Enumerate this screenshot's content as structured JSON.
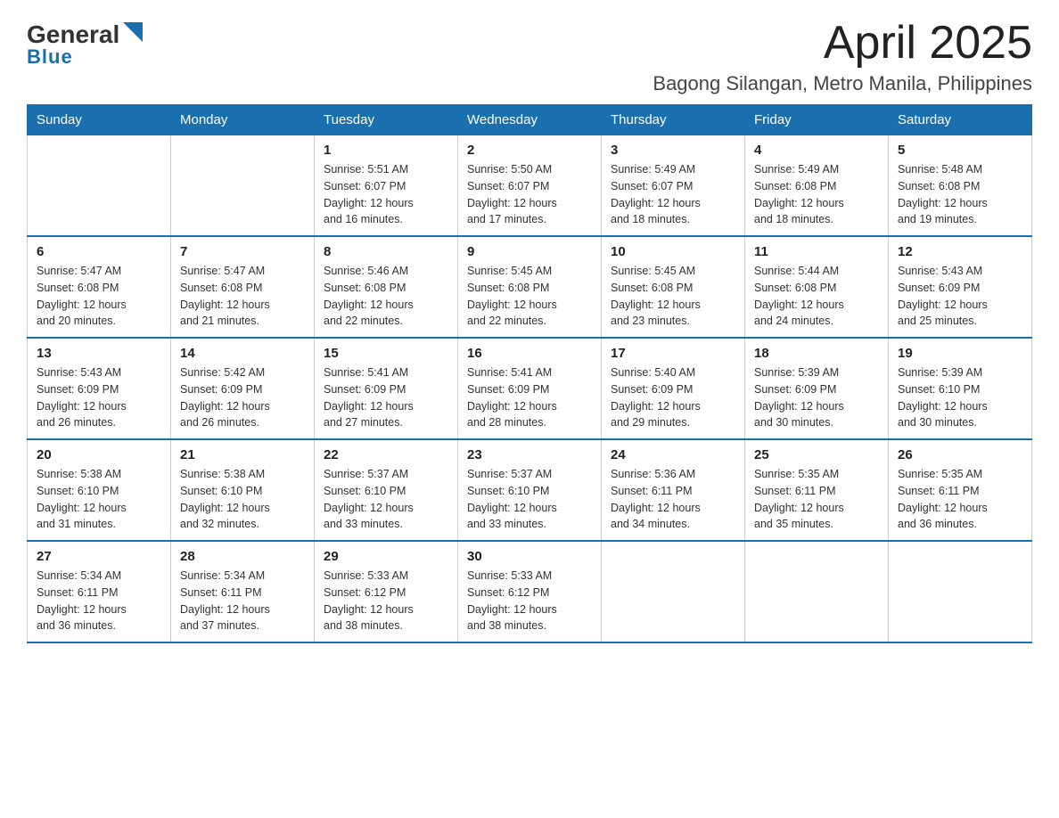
{
  "logo": {
    "line1_black": "General",
    "line1_blue": "Blue",
    "line2": "Blue"
  },
  "header": {
    "month_year": "April 2025",
    "location": "Bagong Silangan, Metro Manila, Philippines"
  },
  "weekdays": [
    "Sunday",
    "Monday",
    "Tuesday",
    "Wednesday",
    "Thursday",
    "Friday",
    "Saturday"
  ],
  "weeks": [
    [
      {
        "day": "",
        "info": ""
      },
      {
        "day": "",
        "info": ""
      },
      {
        "day": "1",
        "info": "Sunrise: 5:51 AM\nSunset: 6:07 PM\nDaylight: 12 hours\nand 16 minutes."
      },
      {
        "day": "2",
        "info": "Sunrise: 5:50 AM\nSunset: 6:07 PM\nDaylight: 12 hours\nand 17 minutes."
      },
      {
        "day": "3",
        "info": "Sunrise: 5:49 AM\nSunset: 6:07 PM\nDaylight: 12 hours\nand 18 minutes."
      },
      {
        "day": "4",
        "info": "Sunrise: 5:49 AM\nSunset: 6:08 PM\nDaylight: 12 hours\nand 18 minutes."
      },
      {
        "day": "5",
        "info": "Sunrise: 5:48 AM\nSunset: 6:08 PM\nDaylight: 12 hours\nand 19 minutes."
      }
    ],
    [
      {
        "day": "6",
        "info": "Sunrise: 5:47 AM\nSunset: 6:08 PM\nDaylight: 12 hours\nand 20 minutes."
      },
      {
        "day": "7",
        "info": "Sunrise: 5:47 AM\nSunset: 6:08 PM\nDaylight: 12 hours\nand 21 minutes."
      },
      {
        "day": "8",
        "info": "Sunrise: 5:46 AM\nSunset: 6:08 PM\nDaylight: 12 hours\nand 22 minutes."
      },
      {
        "day": "9",
        "info": "Sunrise: 5:45 AM\nSunset: 6:08 PM\nDaylight: 12 hours\nand 22 minutes."
      },
      {
        "day": "10",
        "info": "Sunrise: 5:45 AM\nSunset: 6:08 PM\nDaylight: 12 hours\nand 23 minutes."
      },
      {
        "day": "11",
        "info": "Sunrise: 5:44 AM\nSunset: 6:08 PM\nDaylight: 12 hours\nand 24 minutes."
      },
      {
        "day": "12",
        "info": "Sunrise: 5:43 AM\nSunset: 6:09 PM\nDaylight: 12 hours\nand 25 minutes."
      }
    ],
    [
      {
        "day": "13",
        "info": "Sunrise: 5:43 AM\nSunset: 6:09 PM\nDaylight: 12 hours\nand 26 minutes."
      },
      {
        "day": "14",
        "info": "Sunrise: 5:42 AM\nSunset: 6:09 PM\nDaylight: 12 hours\nand 26 minutes."
      },
      {
        "day": "15",
        "info": "Sunrise: 5:41 AM\nSunset: 6:09 PM\nDaylight: 12 hours\nand 27 minutes."
      },
      {
        "day": "16",
        "info": "Sunrise: 5:41 AM\nSunset: 6:09 PM\nDaylight: 12 hours\nand 28 minutes."
      },
      {
        "day": "17",
        "info": "Sunrise: 5:40 AM\nSunset: 6:09 PM\nDaylight: 12 hours\nand 29 minutes."
      },
      {
        "day": "18",
        "info": "Sunrise: 5:39 AM\nSunset: 6:09 PM\nDaylight: 12 hours\nand 30 minutes."
      },
      {
        "day": "19",
        "info": "Sunrise: 5:39 AM\nSunset: 6:10 PM\nDaylight: 12 hours\nand 30 minutes."
      }
    ],
    [
      {
        "day": "20",
        "info": "Sunrise: 5:38 AM\nSunset: 6:10 PM\nDaylight: 12 hours\nand 31 minutes."
      },
      {
        "day": "21",
        "info": "Sunrise: 5:38 AM\nSunset: 6:10 PM\nDaylight: 12 hours\nand 32 minutes."
      },
      {
        "day": "22",
        "info": "Sunrise: 5:37 AM\nSunset: 6:10 PM\nDaylight: 12 hours\nand 33 minutes."
      },
      {
        "day": "23",
        "info": "Sunrise: 5:37 AM\nSunset: 6:10 PM\nDaylight: 12 hours\nand 33 minutes."
      },
      {
        "day": "24",
        "info": "Sunrise: 5:36 AM\nSunset: 6:11 PM\nDaylight: 12 hours\nand 34 minutes."
      },
      {
        "day": "25",
        "info": "Sunrise: 5:35 AM\nSunset: 6:11 PM\nDaylight: 12 hours\nand 35 minutes."
      },
      {
        "day": "26",
        "info": "Sunrise: 5:35 AM\nSunset: 6:11 PM\nDaylight: 12 hours\nand 36 minutes."
      }
    ],
    [
      {
        "day": "27",
        "info": "Sunrise: 5:34 AM\nSunset: 6:11 PM\nDaylight: 12 hours\nand 36 minutes."
      },
      {
        "day": "28",
        "info": "Sunrise: 5:34 AM\nSunset: 6:11 PM\nDaylight: 12 hours\nand 37 minutes."
      },
      {
        "day": "29",
        "info": "Sunrise: 5:33 AM\nSunset: 6:12 PM\nDaylight: 12 hours\nand 38 minutes."
      },
      {
        "day": "30",
        "info": "Sunrise: 5:33 AM\nSunset: 6:12 PM\nDaylight: 12 hours\nand 38 minutes."
      },
      {
        "day": "",
        "info": ""
      },
      {
        "day": "",
        "info": ""
      },
      {
        "day": "",
        "info": ""
      }
    ]
  ]
}
